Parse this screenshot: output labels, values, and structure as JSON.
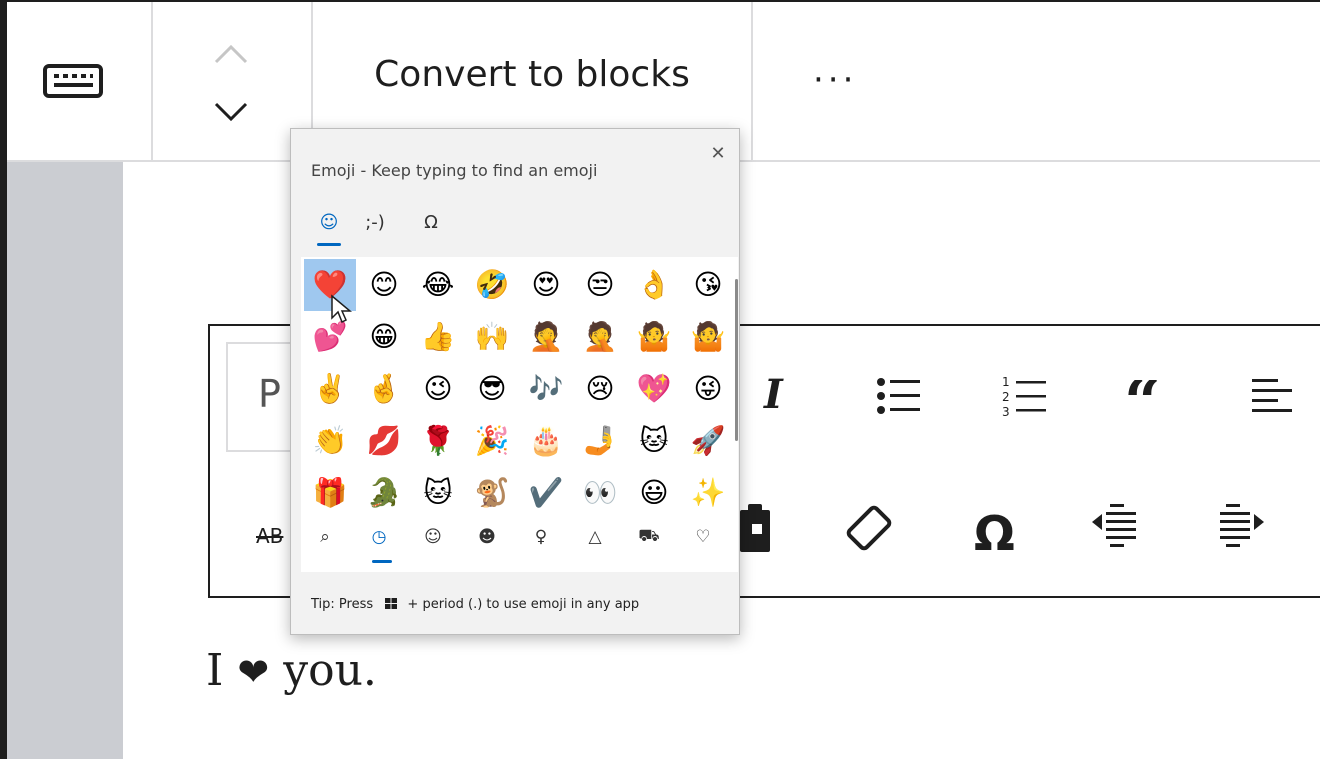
{
  "toolbar": {
    "convert_label": "Convert to blocks",
    "more_label": "···"
  },
  "format_toolbar": {
    "paragraph_letter": "P",
    "strike_label": "AB",
    "icons": [
      "italic-icon",
      "bulleted-list-icon",
      "numbered-list-icon",
      "quote-icon",
      "align-left-icon",
      "paste-icon",
      "eraser-icon",
      "special-characters-icon",
      "outdent-icon",
      "indent-icon"
    ]
  },
  "editor": {
    "sentence_before": "I",
    "sentence_heart": "❤",
    "sentence_after": "you."
  },
  "emoji_panel": {
    "title": "Emoji - Keep typing to find an emoji",
    "close_label": "✕",
    "tabs": [
      {
        "label": "☺",
        "name": "emoji"
      },
      {
        "label": ";-)",
        "name": "kaomoji"
      },
      {
        "label": "Ω",
        "name": "symbols"
      }
    ],
    "emojis": [
      [
        "❤️",
        "😊",
        "😂",
        "🤣",
        "😍",
        "😒",
        "👌",
        "😘"
      ],
      [
        "💕",
        "😁",
        "👍",
        "🙌",
        "🤦",
        "🤦",
        "🤷",
        "🤷"
      ],
      [
        "✌️",
        "🤞",
        "😉",
        "😎",
        "🎶",
        "😢",
        "💖",
        "😜"
      ],
      [
        "👏",
        "💋",
        "🌹",
        "🎉",
        "🎂",
        "🤳",
        "🐱",
        "🚀"
      ],
      [
        "🎁",
        "🐊",
        "🐱",
        "🐒",
        "✔️",
        "👀",
        "😃",
        "✨"
      ]
    ],
    "categories": [
      {
        "label": "⌕",
        "name": "search-icon"
      },
      {
        "label": "◷",
        "name": "recent-clock-icon"
      },
      {
        "label": "☺",
        "name": "smiley-icon"
      },
      {
        "label": "☻",
        "name": "people-icon"
      },
      {
        "label": "♀",
        "name": "celebration-icon"
      },
      {
        "label": "△",
        "name": "food-icon"
      },
      {
        "label": "⛟",
        "name": "travel-car-icon"
      },
      {
        "label": "♡",
        "name": "heart-icon"
      }
    ],
    "tip_before": "Tip: Press",
    "tip_after": "+ period (.) to use emoji in any app"
  },
  "colors": {
    "accent": "#0067c0",
    "selected": "#9fc8ef",
    "gutter": "#cbcdd2"
  }
}
